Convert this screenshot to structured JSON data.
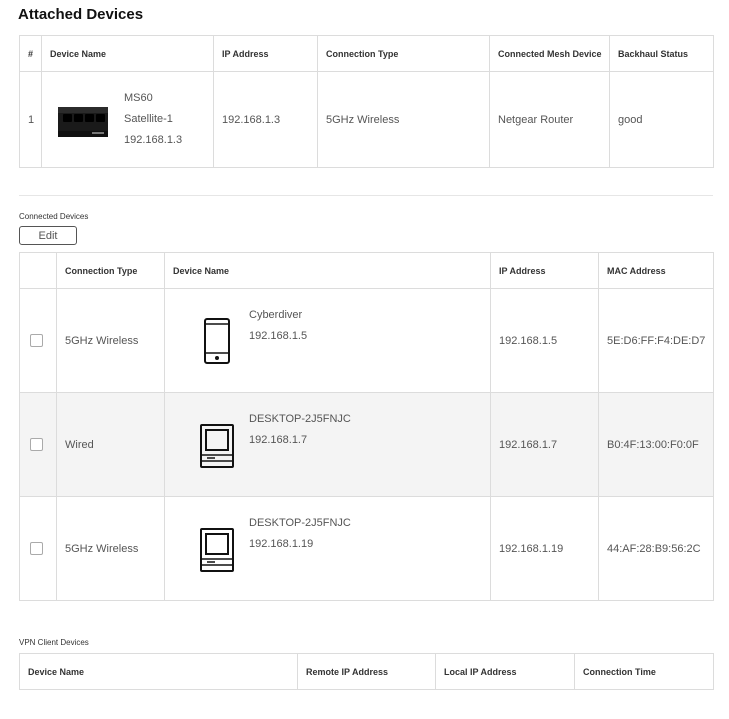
{
  "attached": {
    "title": "Attached Devices",
    "headers": [
      "#",
      "Device Name",
      "IP Address",
      "Connection Type",
      "Connected Mesh Device",
      "Backhaul Status"
    ],
    "rows": [
      {
        "num": "1",
        "model": "MS60",
        "name": "Satellite-1",
        "device_ip": "192.168.1.3",
        "ip": "192.168.1.3",
        "connection": "5GHz Wireless",
        "mesh": "Netgear Router",
        "backhaul": "good",
        "icon": "mesh-satellite-icon"
      }
    ]
  },
  "connected": {
    "label": "Connected Devices",
    "edit_label": "Edit",
    "headers": [
      "",
      "Connection Type",
      "Device Name",
      "IP Address",
      "MAC Address"
    ],
    "rows": [
      {
        "connection": "5GHz Wireless",
        "name": "Cyberdiver",
        "device_ip": "192.168.1.5",
        "ip": "192.168.1.5",
        "mac": "5E:D6:FF:F4:DE:D7",
        "icon": "phone-icon"
      },
      {
        "connection": "Wired",
        "name": "DESKTOP-2J5FNJC",
        "device_ip": "192.168.1.7",
        "ip": "192.168.1.7",
        "mac": "B0:4F:13:00:F0:0F",
        "icon": "computer-icon"
      },
      {
        "connection": "5GHz Wireless",
        "name": "DESKTOP-2J5FNJC",
        "device_ip": "192.168.1.19",
        "ip": "192.168.1.19",
        "mac": "44:AF:28:B9:56:2C",
        "icon": "computer-icon"
      }
    ]
  },
  "vpn": {
    "label": "VPN Client Devices",
    "headers": [
      "Device Name",
      "Remote IP Address",
      "Local IP Address",
      "Connection Time"
    ]
  }
}
